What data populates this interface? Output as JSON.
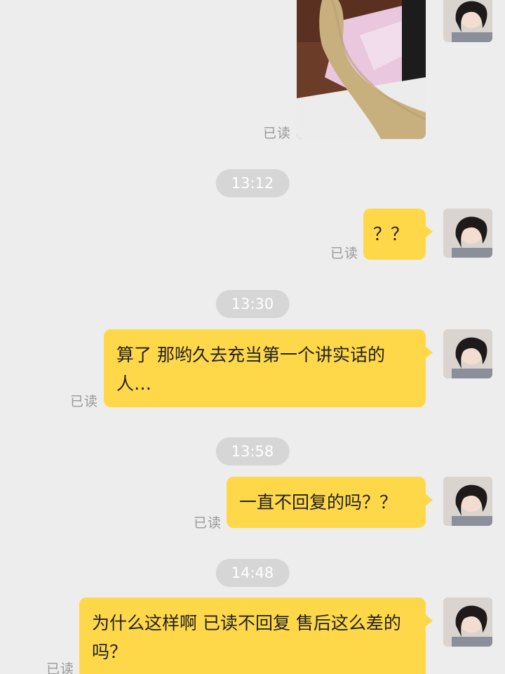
{
  "read_label": "已读",
  "timestamps": [
    "13:12",
    "13:30",
    "13:58",
    "14:48"
  ],
  "messages": [
    {
      "text": "？？"
    },
    {
      "text": "算了 那哟久去充当第一个讲实话的人…"
    },
    {
      "text": "一直不回复的吗？？"
    },
    {
      "text": "为什么这样啊 已读不回复 售后这么差的吗？"
    }
  ],
  "colors": {
    "background": "#ededed",
    "bubble": "#ffd84a",
    "timestamp_pill": "#d6d6d6",
    "read_label": "#999999"
  }
}
